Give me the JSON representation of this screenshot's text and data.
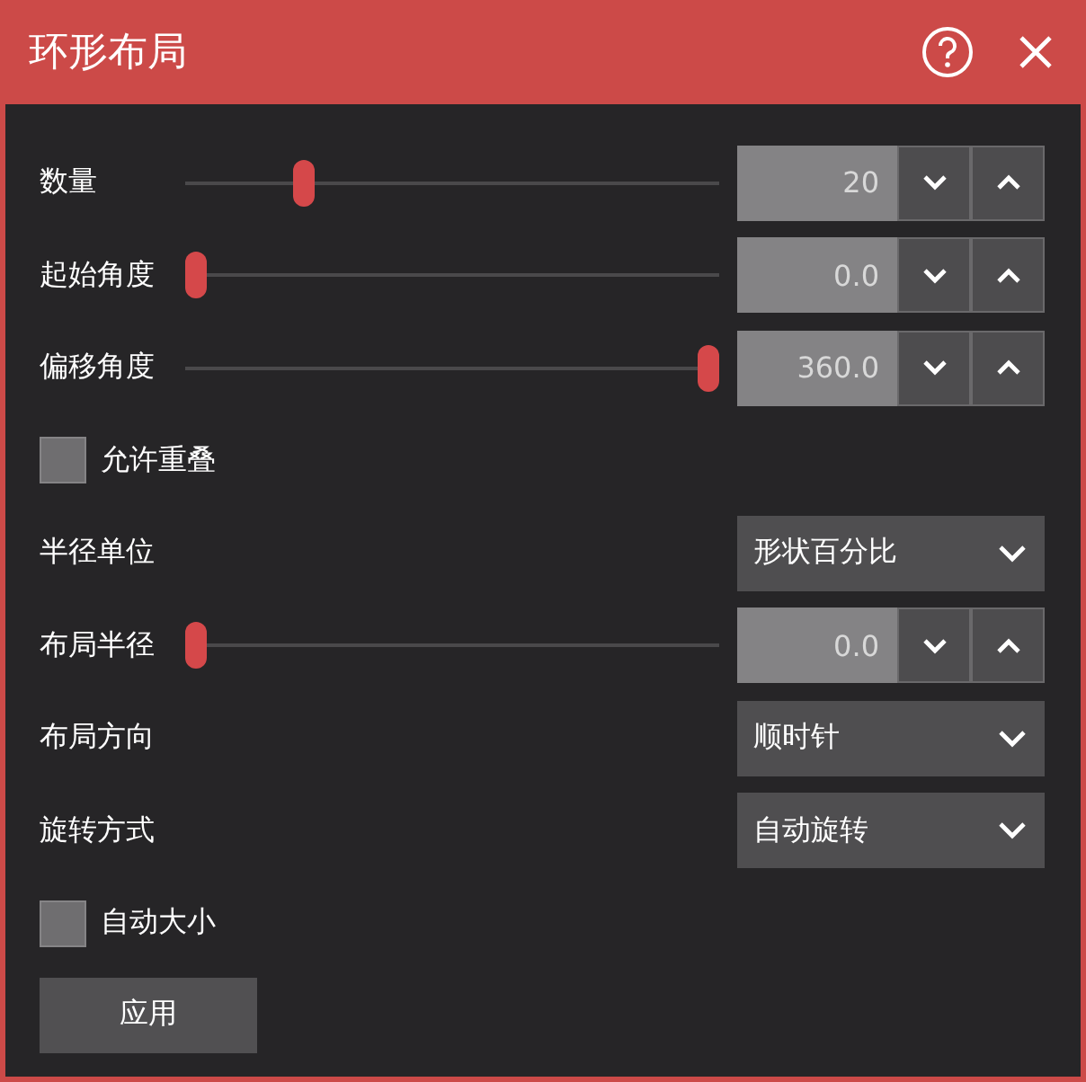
{
  "window": {
    "title": "环形布局"
  },
  "rows": [
    {
      "kind": "slider",
      "label": "数量",
      "level": 0.21,
      "value": "20"
    },
    {
      "kind": "slider",
      "label": "起始角度",
      "level": 0,
      "value": "0.0"
    },
    {
      "kind": "slider",
      "label": "偏移角度",
      "level": 1,
      "value": "360.0"
    },
    {
      "kind": "checkbox",
      "label": "允许重叠",
      "checked": false
    },
    {
      "kind": "select",
      "label": "半径单位",
      "value": "形状百分比"
    },
    {
      "kind": "slider",
      "label": "布局半径",
      "level": 0,
      "value": "0.0"
    },
    {
      "kind": "select",
      "label": "布局方向",
      "value": "顺时针"
    },
    {
      "kind": "select",
      "label": "旋转方式",
      "value": "自动旋转"
    },
    {
      "kind": "checkbox",
      "label": "自动大小",
      "checked": false
    }
  ],
  "buttons": [
    "应用"
  ]
}
